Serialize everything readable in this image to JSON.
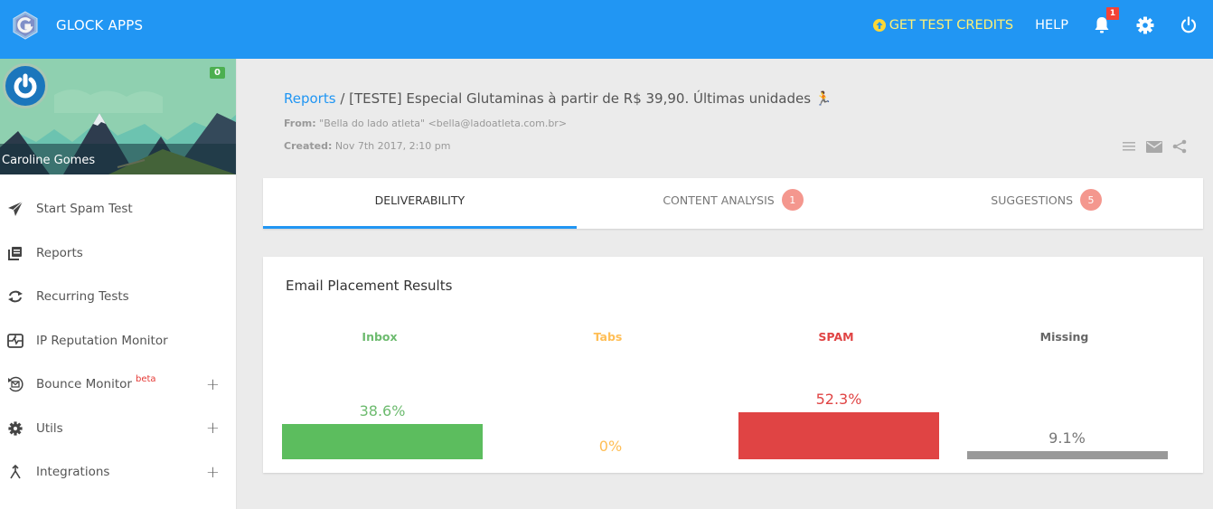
{
  "app": {
    "name": "GLOCK APPS",
    "brand_color": "#2196f3"
  },
  "topbar": {
    "get_credits_label": "GET TEST CREDITS",
    "help_label": "HELP",
    "notifications_count": "1",
    "icons": [
      "upload-circle-icon",
      "bell-icon",
      "gear-icon",
      "power-icon"
    ]
  },
  "profile": {
    "name": "Caroline Gomes",
    "credits": "0"
  },
  "sidebar": {
    "items": [
      {
        "label": "Start Spam Test",
        "icon": "paper-plane-icon"
      },
      {
        "label": "Reports",
        "icon": "reports-icon"
      },
      {
        "label": "Recurring Tests",
        "icon": "sync-icon"
      },
      {
        "label": "IP Reputation Monitor",
        "icon": "monitor-icon"
      },
      {
        "label": "Bounce Monitor",
        "icon": "bounce-icon",
        "tag": "beta",
        "expandable": "+"
      },
      {
        "label": "Utils",
        "icon": "gear-icon",
        "expandable": "+"
      },
      {
        "label": "Integrations",
        "icon": "merge-icon",
        "expandable": "+"
      }
    ]
  },
  "report": {
    "breadcrumb_root": "Reports",
    "separator": " / ",
    "title": "[TESTE] Especial Glutaminas à partir de R$ 39,90. Últimas unidades 🏃",
    "from_label": "From:",
    "from_value": "\"Bella do lado atleta\" <bella@ladoatleta.com.br>",
    "created_label": "Created:",
    "created_value": "Nov 7th 2017, 2:10 pm"
  },
  "tabs": [
    {
      "label": "DELIVERABILITY",
      "active": true
    },
    {
      "label": "CONTENT ANALYSIS",
      "badge": "1"
    },
    {
      "label": "SUGGESTIONS",
      "badge": "5"
    }
  ],
  "placement": {
    "title": "Email Placement Results",
    "chart_data": {
      "type": "bar",
      "title": "Email Placement Results",
      "categories": [
        "Inbox",
        "Tabs",
        "SPAM",
        "Missing"
      ],
      "values": [
        38.6,
        0,
        52.3,
        9.1
      ],
      "value_labels": [
        "38.6%",
        "0%",
        "52.3%",
        "9.1%"
      ],
      "colors": [
        "#5cbd5e",
        "#ffbe55",
        "#e04444",
        "#999999"
      ],
      "label_colors": [
        "#6dbb6f",
        "#ffbe55",
        "#e04444",
        "#666666"
      ],
      "unit": "%",
      "ylim": [
        0,
        100
      ]
    }
  }
}
